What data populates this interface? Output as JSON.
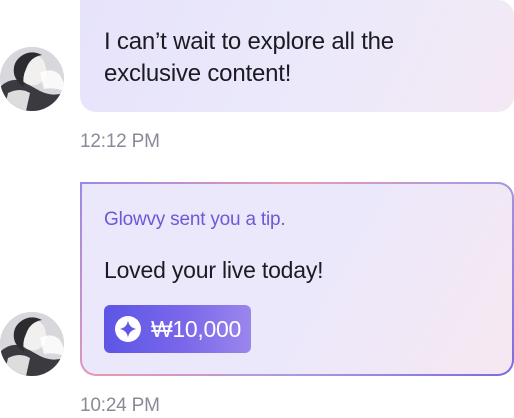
{
  "messages": [
    {
      "text": "I can’t wait to explore all the exclusive content!",
      "time": "12:12 PM",
      "avatar_icon": "user-avatar"
    },
    {
      "tip_header": "Glowvy sent you a tip.",
      "text": "Loved your live today!",
      "tip_amount": "₩10,000",
      "tip_icon": "sparkle-icon",
      "time": "10:24 PM",
      "avatar_icon": "user-avatar"
    }
  ],
  "colors": {
    "accent": "#6a5ad6",
    "chip_start": "#5d55e6",
    "chip_end": "#9b86ec",
    "timestamp": "#8a8a98"
  }
}
